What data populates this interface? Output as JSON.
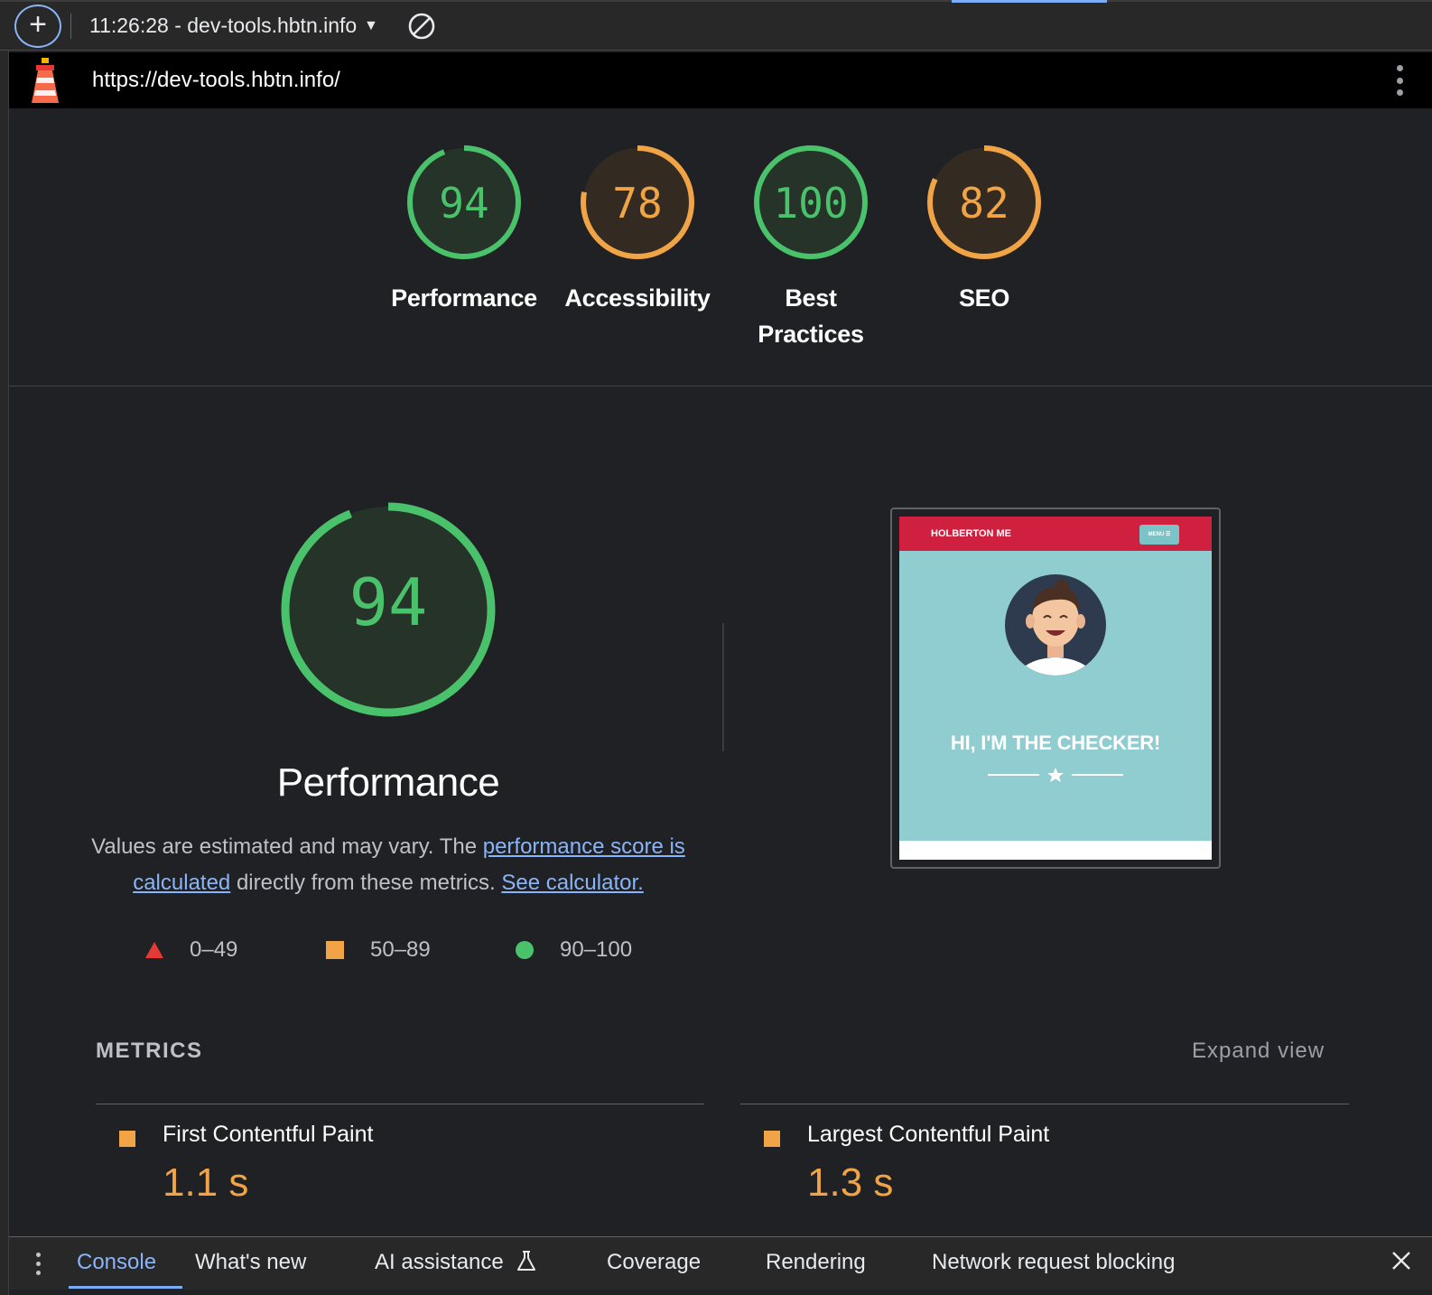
{
  "toolbar": {
    "add_icon": "plus-icon",
    "report_label": "11:26:28 - dev-tools.hbtn.info",
    "clear_icon": "block-icon"
  },
  "urlbar": {
    "url": "https://dev-tools.hbtn.info/",
    "logo": "lighthouse-logo"
  },
  "gauges": [
    {
      "score": "94",
      "label": "Performance",
      "status": "pass",
      "fraction": 0.94
    },
    {
      "score": "78",
      "label": "Accessibility",
      "status": "average",
      "fraction": 0.78
    },
    {
      "score": "100",
      "label": "Best Practices",
      "status": "pass",
      "fraction": 1.0
    },
    {
      "score": "82",
      "label": "SEO",
      "status": "average",
      "fraction": 0.82
    }
  ],
  "performance": {
    "score": "94",
    "fraction": 0.94,
    "title": "Performance",
    "desc_prefix": "Values are estimated and may vary. The ",
    "desc_link1": "performance score is calculated",
    "desc_middle": " directly from these metrics. ",
    "desc_link2": "See calculator."
  },
  "legend": [
    {
      "range": "0–49",
      "shape": "triangle",
      "color": "#e53935"
    },
    {
      "range": "50–89",
      "shape": "square",
      "color": "#f0a445"
    },
    {
      "range": "90–100",
      "shape": "circle",
      "color": "#4ac26b"
    }
  ],
  "thumbnail": {
    "brand": "HOLBERTON ME",
    "menu": "MENU ☰",
    "hero": "HI, I'M THE CHECKER!"
  },
  "metrics": {
    "heading": "METRICS",
    "expand": "Expand view",
    "items": [
      {
        "name": "First Contentful Paint",
        "value": "1.1 s",
        "status": "average"
      },
      {
        "name": "Largest Contentful Paint",
        "value": "1.3 s",
        "status": "average"
      }
    ]
  },
  "drawer": {
    "tabs": [
      "Console",
      "What's new",
      "AI assistance",
      "Coverage",
      "Rendering",
      "Network request blocking"
    ],
    "active": "Console"
  },
  "colors": {
    "pass": "#4ac26b",
    "average": "#f0a445",
    "fail": "#e53935",
    "link": "#8ab4f8"
  }
}
